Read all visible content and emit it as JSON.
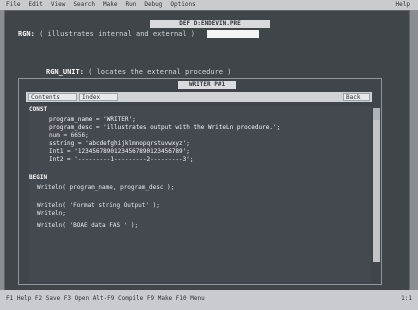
{
  "menu": {
    "items": [
      "File",
      "Edit",
      "View",
      "Search",
      "Make",
      "Run",
      "Debug",
      "Options"
    ],
    "help": "Help"
  },
  "outer_window": {
    "title": "DEF D:ENDEVIN.PRE"
  },
  "form": {
    "row1_label": "RGN:",
    "row1_value": "( illustrates internal and external )",
    "row2_label": "RGN_UNIT:",
    "row2_value": "( locates the external procedure )"
  },
  "writer_window": {
    "title": "WRITER P#1",
    "buttons": {
      "contents": "Contents",
      "index": "Index",
      "back": "Back"
    }
  },
  "code": {
    "lines": [
      "CONST",
      "program_name = 'WRITER';",
      "program_desc = 'illustrates output with the WriteLn procedure.';",
      "num = 6656;",
      "sstring = 'abcdefghijklmnopqrstuvwxyz';",
      "Int1 = '12345678901234567890123456789';",
      "Int2 = '---------1---------2---------3';",
      "BEGIN",
      "Writeln( program_name, program_desc );",
      "Writeln( 'Format string      Output' );",
      "Writeln;",
      "Writeln( 'BOAE data          FAS ' );"
    ]
  },
  "status": {
    "left": "F1 Help  F2 Save  F3 Open  Alt-F9 Compile  F9 Make  F10 Menu",
    "right": "1:1"
  }
}
